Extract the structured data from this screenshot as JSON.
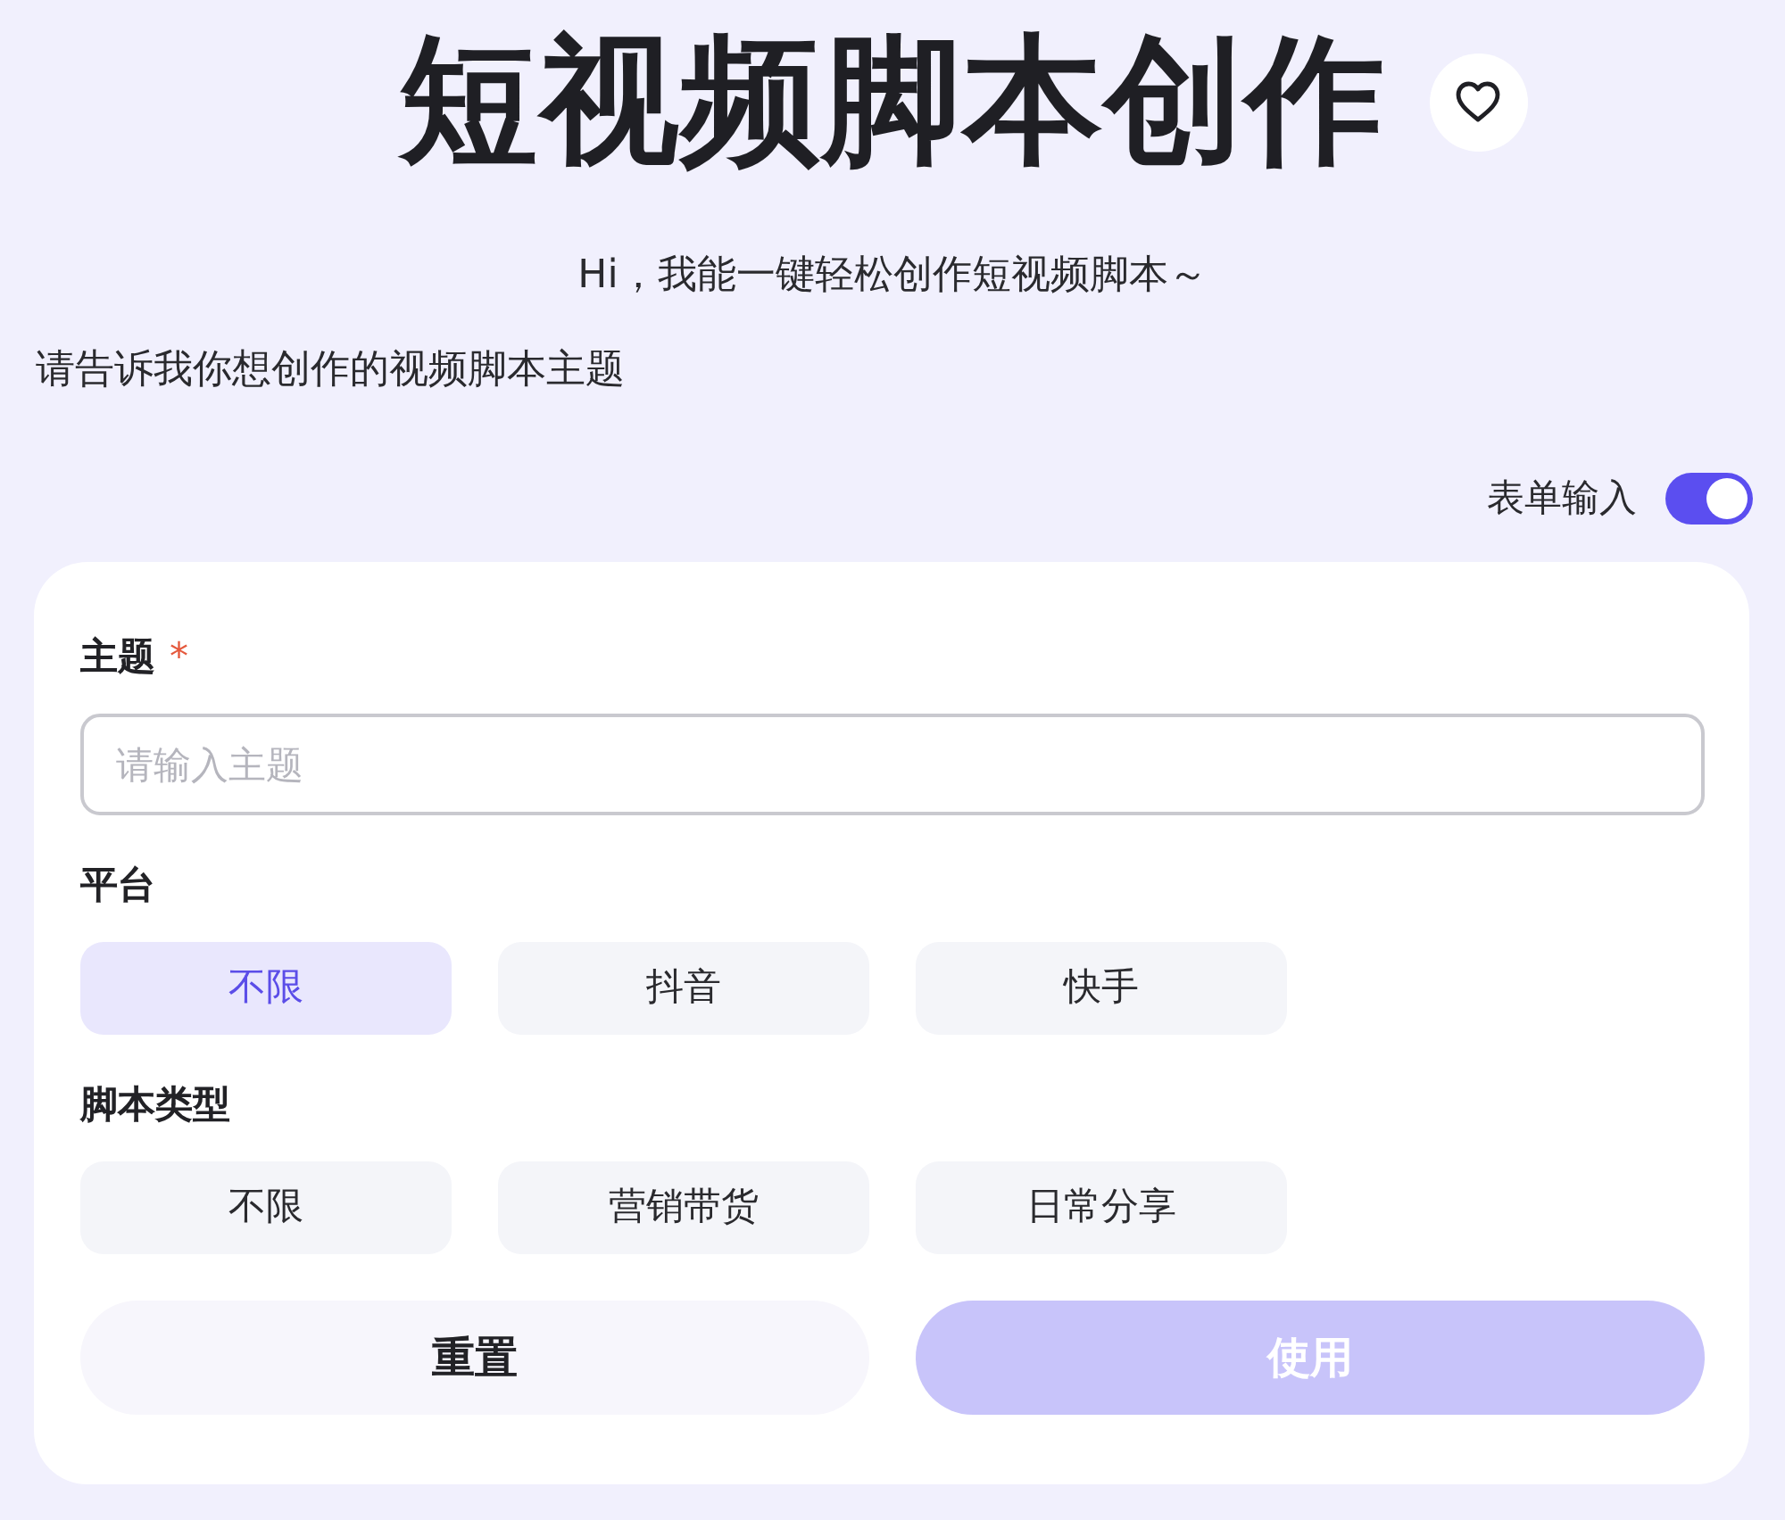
{
  "title": "短视频脚本创作",
  "greeting": "Hi，我能一键轻松创作短视频脚本～",
  "prompt": "请告诉我你想创作的视频脚本主题",
  "form_toggle": {
    "label": "表单输入",
    "on": true
  },
  "form": {
    "fields": [
      {
        "kind": "text",
        "label": "主题",
        "required_mark": "*",
        "placeholder": "请输入主题"
      },
      {
        "kind": "choice",
        "label": "平台",
        "options": [
          {
            "label": "不限",
            "selected": true
          },
          {
            "label": "抖音",
            "selected": false
          },
          {
            "label": "快手",
            "selected": false
          }
        ]
      },
      {
        "kind": "choice",
        "label": "脚本类型",
        "options": [
          {
            "label": "不限",
            "selected": false
          },
          {
            "label": "营销带货",
            "selected": false
          },
          {
            "label": "日常分享",
            "selected": false
          }
        ]
      }
    ],
    "buttons": [
      {
        "label": "重置",
        "kind": "secondary",
        "disabled": false
      },
      {
        "label": "使用",
        "kind": "primary",
        "disabled": true
      }
    ]
  }
}
